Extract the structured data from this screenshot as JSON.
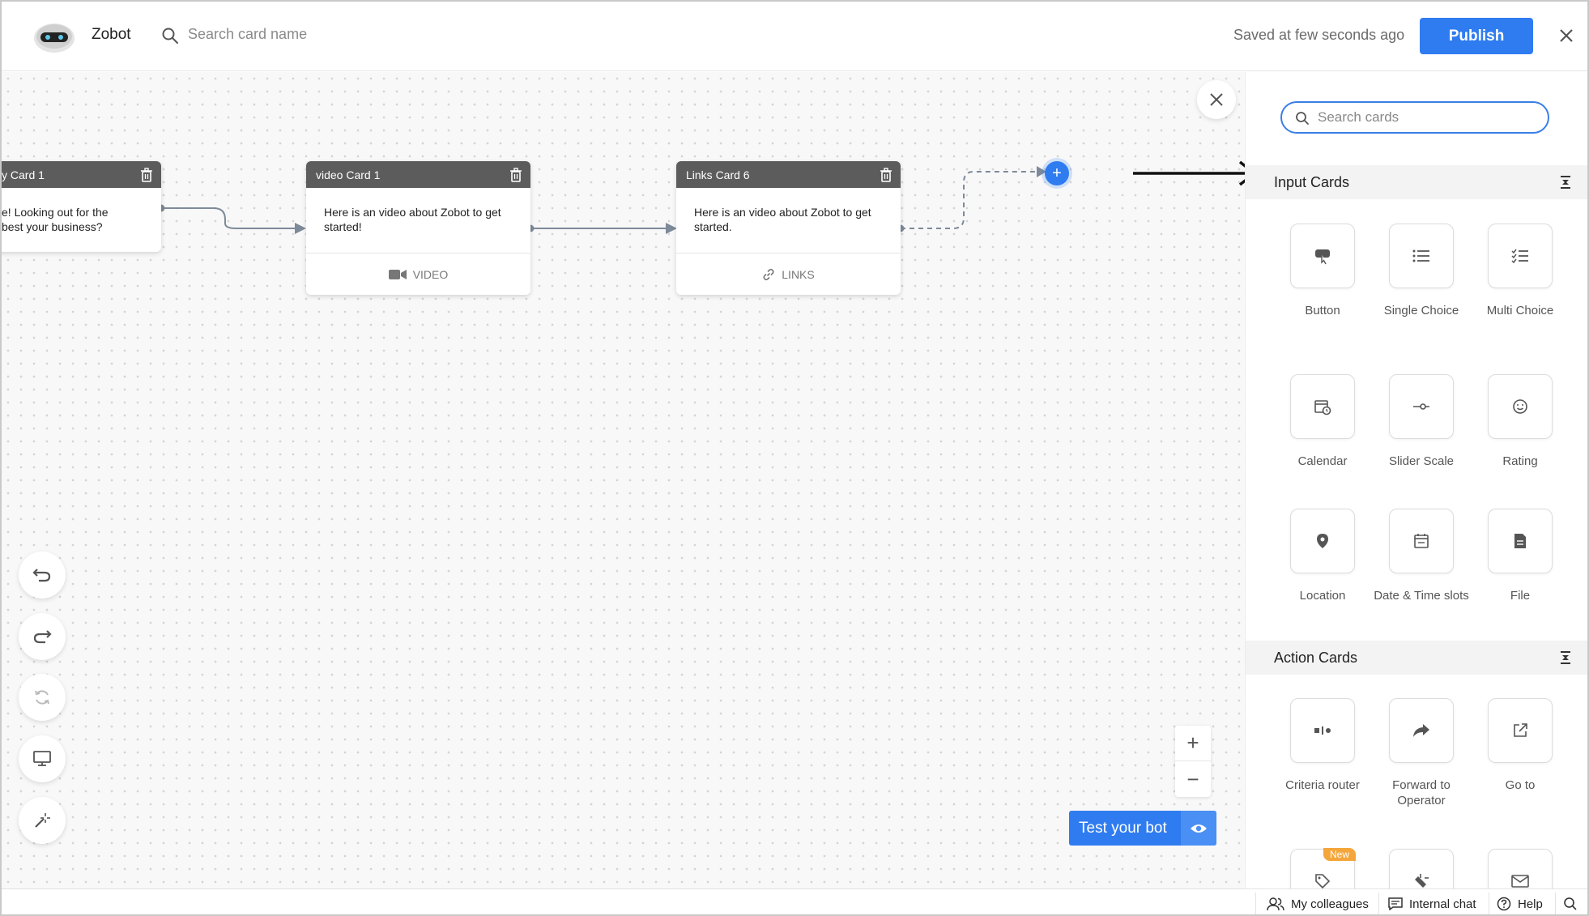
{
  "header": {
    "app_name": "Zobot",
    "search_placeholder": "Search card name",
    "saved_status": "Saved at few seconds ago",
    "publish_label": "Publish"
  },
  "canvas": {
    "cards": [
      {
        "title": "y Card 1",
        "body": "e! Looking out for the best your business?"
      },
      {
        "title": "video Card 1",
        "body": "Here is an video about Zobot to get started!",
        "footer": "VIDEO"
      },
      {
        "title": "Links Card 6",
        "body": "Here is an video about Zobot to get started.",
        "footer": "LINKS"
      }
    ],
    "add_node_label": "+",
    "test_bot_label": "Test your bot",
    "zoom_in": "+",
    "zoom_out": "−"
  },
  "panel": {
    "search_placeholder": "Search cards",
    "input_section_title": "Input Cards",
    "input_cards": [
      {
        "label": "Button",
        "icon": "button-icon"
      },
      {
        "label": "Single Choice",
        "icon": "list-icon"
      },
      {
        "label": "Multi Choice",
        "icon": "checklist-icon"
      },
      {
        "label": "Calendar",
        "icon": "calendar-icon"
      },
      {
        "label": "Slider Scale",
        "icon": "slider-icon"
      },
      {
        "label": "Rating",
        "icon": "smiley-icon"
      },
      {
        "label": "Location",
        "icon": "location-pin-icon"
      },
      {
        "label": "Date & Time slots",
        "icon": "date-slots-icon"
      },
      {
        "label": "File",
        "icon": "file-icon"
      }
    ],
    "action_section_title": "Action Cards",
    "action_cards": [
      {
        "label": "Criteria router",
        "icon": "router-icon"
      },
      {
        "label": "Forward to Operator",
        "icon": "forward-icon"
      },
      {
        "label": "Go to",
        "icon": "external-link-icon"
      },
      {
        "label": "",
        "icon": "tag-icon",
        "badge": "New"
      },
      {
        "label": "",
        "icon": "plug-icon"
      },
      {
        "label": "",
        "icon": "mail-icon"
      }
    ]
  },
  "bottom_bar": {
    "colleagues": "My colleagues",
    "internal_chat": "Internal chat",
    "help": "Help"
  },
  "colors": {
    "accent": "#2f7cf0",
    "card_header": "#5c5c5c",
    "panel_section": "#f3f3f3"
  }
}
